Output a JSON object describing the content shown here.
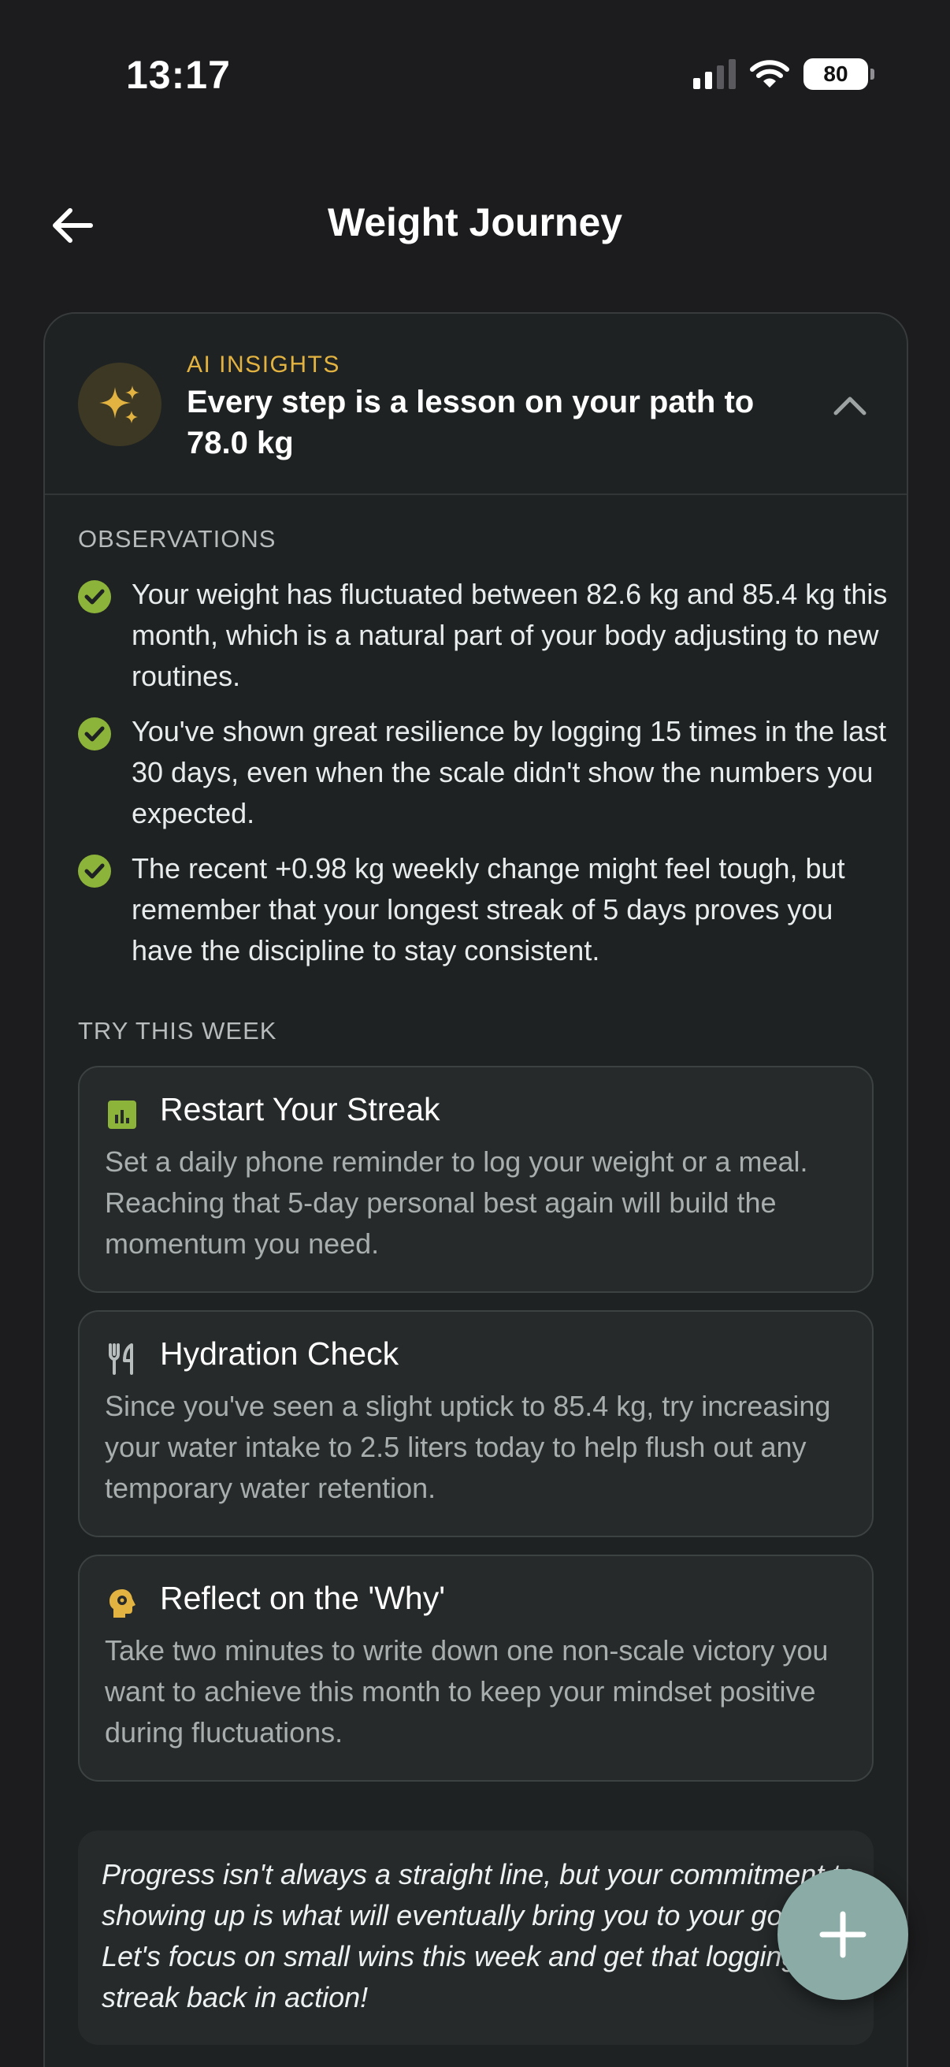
{
  "status_bar": {
    "time": "13:17",
    "battery": "80",
    "signal_bars_active": 2,
    "icons": [
      "cellular-signal-icon",
      "wifi-icon",
      "battery-icon"
    ]
  },
  "header": {
    "title": "Weight Journey",
    "back_icon": "arrow-left-icon"
  },
  "insights": {
    "kicker": "AI INSIGHTS",
    "title": "Every step is a lesson on your path to 78.0 kg",
    "badge_icon": "sparkles-icon",
    "chevron_icon": "chevron-up-icon",
    "accent_color": "#e3b341"
  },
  "observations": {
    "label": "OBSERVATIONS",
    "check_color": "#8cb33a",
    "items": [
      {
        "text": "Your weight has fluctuated between 82.6 kg and 85.4 kg this month, which is a natural part of your body adjusting to new routines."
      },
      {
        "text": "You've shown great resilience by logging 15 times in the last 30 days, even when the scale didn't show the numbers you expected."
      },
      {
        "text": "The recent +0.98 kg weekly change might feel tough, but remember that your longest streak of 5 days proves you have the discipline to stay consistent."
      }
    ]
  },
  "try_this_week": {
    "label": "TRY THIS WEEK",
    "tips": [
      {
        "icon": "chart-icon",
        "icon_color": "#8cb33a",
        "title": "Restart Your Streak",
        "body": "Set a daily phone reminder to log your weight or a meal. Reaching that 5-day personal best again will build the momentum you need."
      },
      {
        "icon": "utensils-icon",
        "icon_color": "#b8bdbd",
        "title": "Hydration Check",
        "body": "Since you've seen a slight uptick to 85.4 kg, try increasing your water intake to 2.5 liters today to help flush out any temporary water retention."
      },
      {
        "icon": "mind-icon",
        "icon_color": "#e3b341",
        "title": "Reflect on the 'Why'",
        "body": "Take two minutes to write down one non-scale victory you want to achieve this month to keep your mindset positive during fluctuations."
      }
    ]
  },
  "motivation": {
    "text": "Progress isn't always a straight line, but your commitment to showing up is what will eventually bring you to your goal. Let's focus on small wins this week and get that logging streak back in action!"
  },
  "fab": {
    "icon": "plus-icon",
    "color": "#8aaba6"
  }
}
